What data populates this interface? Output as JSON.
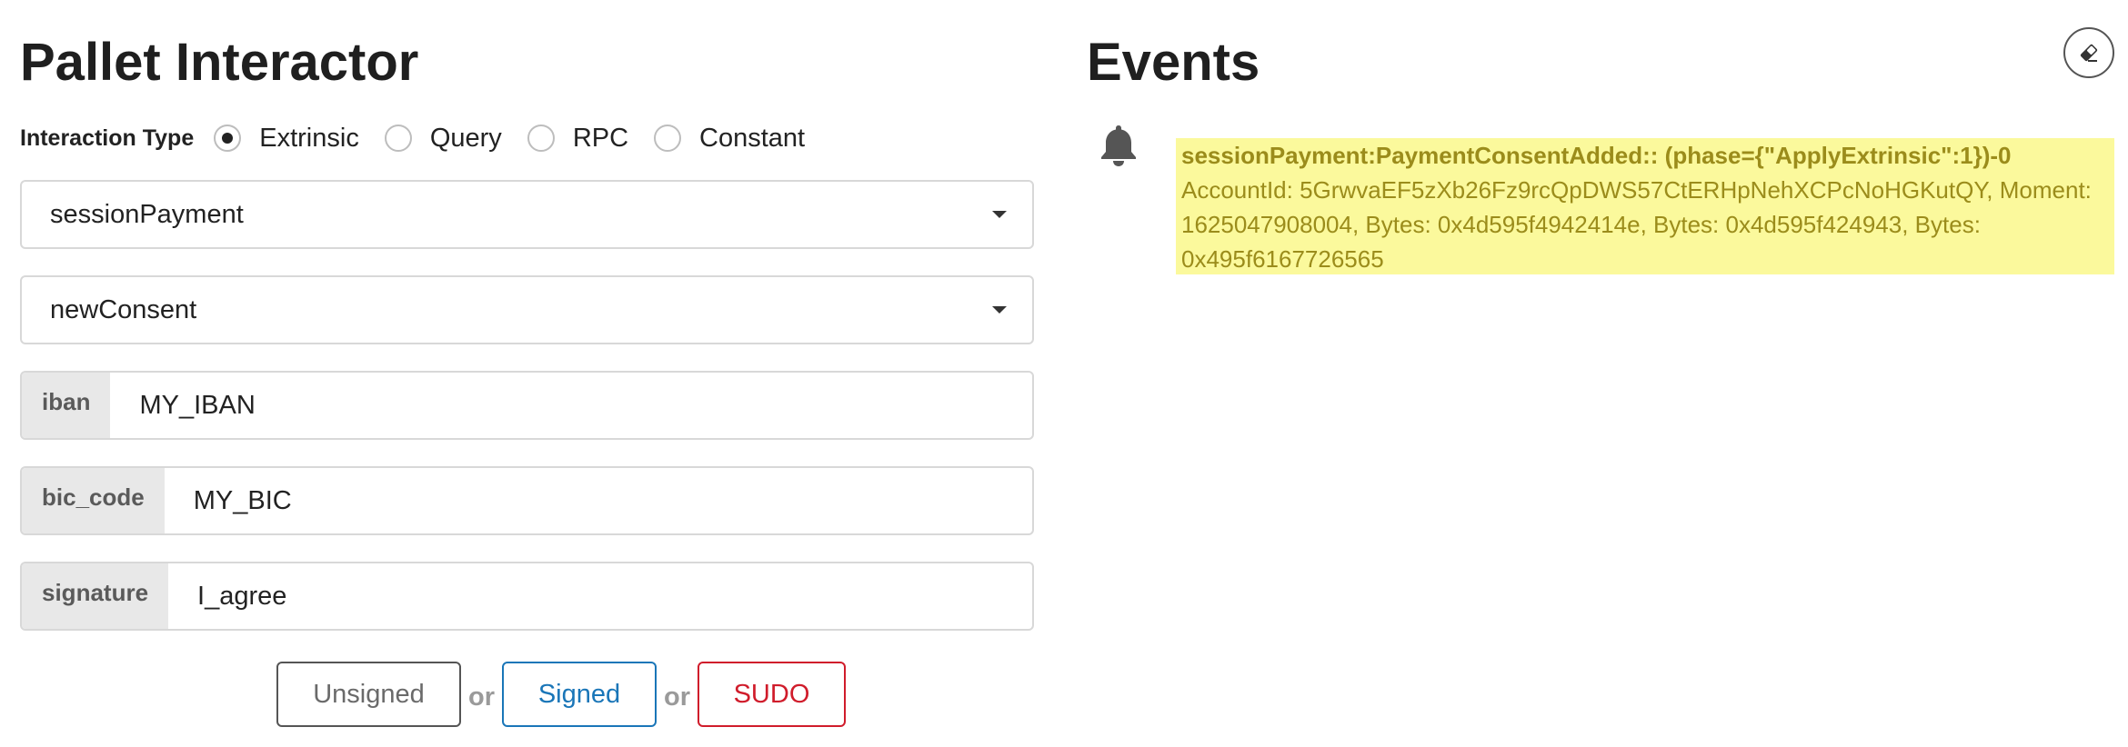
{
  "pallet_interactor": {
    "title": "Pallet Interactor",
    "interaction_type_label": "Interaction Type",
    "interaction_types": [
      {
        "label": "Extrinsic",
        "checked": true
      },
      {
        "label": "Query",
        "checked": false
      },
      {
        "label": "RPC",
        "checked": false
      },
      {
        "label": "Constant",
        "checked": false
      }
    ],
    "pallet_select": {
      "value": "sessionPayment"
    },
    "callable_select": {
      "value": "newConsent"
    },
    "params": [
      {
        "label": "iban",
        "value": "MY_IBAN"
      },
      {
        "label": "bic_code",
        "value": "MY_BIC"
      },
      {
        "label": "signature",
        "value": "I_agree"
      }
    ],
    "buttons": {
      "unsigned": "Unsigned",
      "or": "or",
      "signed": "Signed",
      "sudo": "SUDO"
    }
  },
  "events": {
    "title": "Events",
    "clear_icon": "eraser-icon",
    "items": [
      {
        "icon": "bell-icon",
        "title": "sessionPayment:PaymentConsentAdded:: (phase={\"ApplyExtrinsic\":1})-0",
        "description": "AccountId: 5GrwvaEF5zXb26Fz9rcQpDWS57CtERHpNehXCPcNoHGKutQY, Moment: 1625047908004, Bytes: 0x4d595f4942414e, Bytes: 0x4d595f424943, Bytes: 0x495f6167726565",
        "highlight_color": "#fbf99c",
        "text_color": "#9b8c1b"
      }
    ]
  }
}
